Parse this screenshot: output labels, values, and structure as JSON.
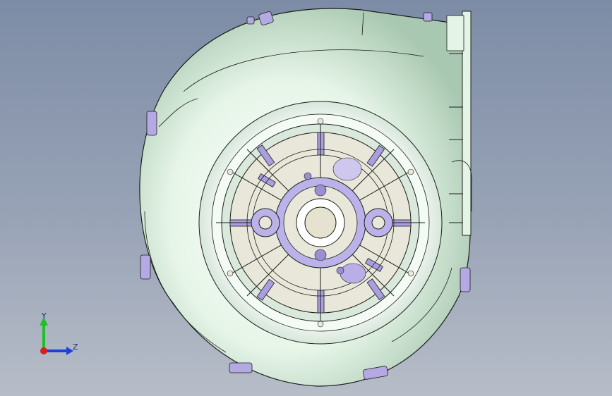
{
  "viewport": {
    "background_top": "#7d8ca6",
    "background_bottom": "#b7bdc8"
  },
  "model": {
    "body_color": "#e4f4e6",
    "body_shadow_color": "#9fbfa8",
    "edge_color": "#1a1f1a",
    "feature_color": "#9a8fd3",
    "hub_color": "#e9e6da"
  },
  "triad": {
    "y_label": "Y",
    "z_label": "Z",
    "y_color": "#1fbf2a",
    "z_color": "#1f3fd8",
    "x_color": "#d81f1f"
  }
}
